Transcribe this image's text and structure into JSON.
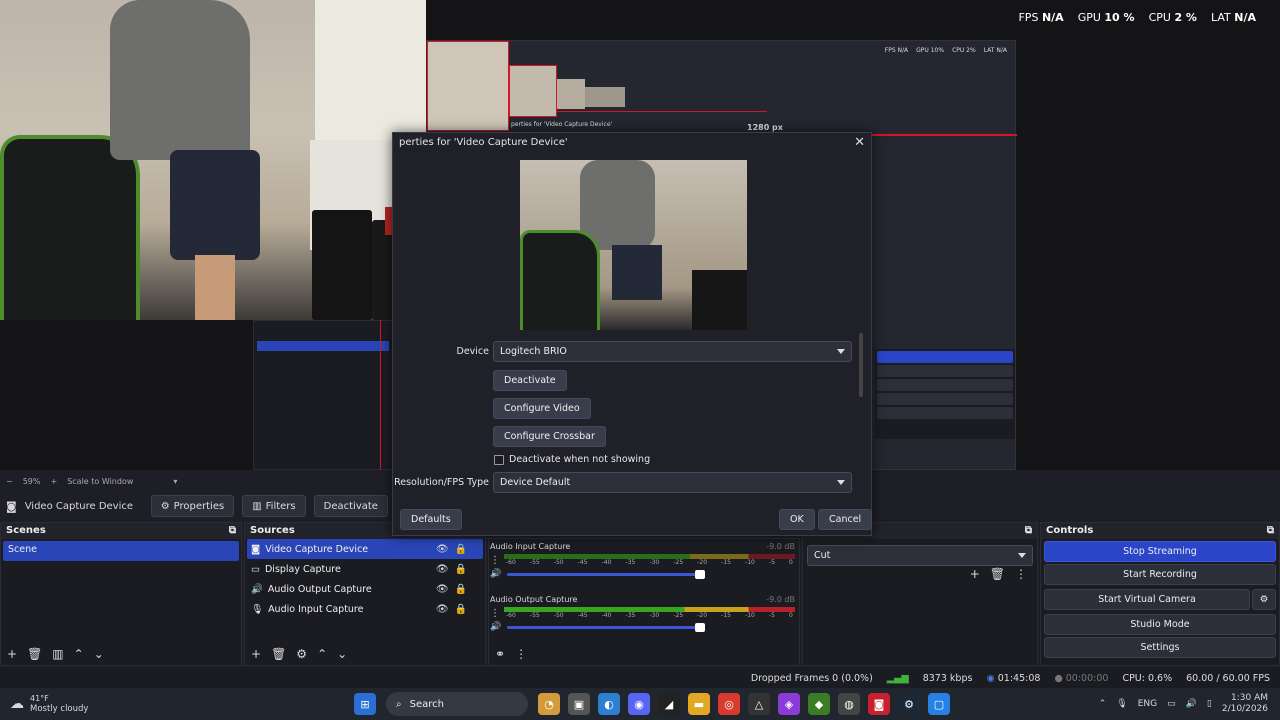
{
  "stats": {
    "fps_label": "FPS",
    "fps_val": "N/A",
    "gpu_label": "GPU",
    "gpu_val": "10 %",
    "cpu_label": "CPU",
    "cpu_val": "2 %",
    "lat_label": "LAT",
    "lat_val": "N/A"
  },
  "nested": {
    "fps": "FPS N/A",
    "gpu": "GPU 10%",
    "cpu": "CPU 2%",
    "lat": "LAT N/A",
    "px_label": "1280 px",
    "props_title": "perties for 'Video Capture Device'"
  },
  "dialog": {
    "title": "perties for 'Video Capture Device'",
    "close": "✕",
    "device_label": "Device",
    "device_value": "Logitech BRIO",
    "deactivate": "Deactivate",
    "configure_video": "Configure Video",
    "configure_crossbar": "Configure Crossbar",
    "deactivate_not_showing": "Deactivate when not showing",
    "resolution_label": "Resolution/FPS Type",
    "resolution_value": "Device Default",
    "defaults": "Defaults",
    "ok": "OK",
    "cancel": "Cancel"
  },
  "zoom": {
    "minus": "−",
    "percent": "59%",
    "plus": "+",
    "scale": "Scale to Window"
  },
  "source_toolbar": {
    "name": "Video Capture Device",
    "properties": "Properties",
    "filters": "Filters",
    "deactivate": "Deactivate"
  },
  "scenes": {
    "title": "Scenes",
    "items": [
      "Scene"
    ]
  },
  "sources": {
    "title": "Sources",
    "items": [
      "Video Capture Device",
      "Display Capture",
      "Audio Output Capture",
      "Audio Input Capture"
    ]
  },
  "mixer": {
    "channels": [
      {
        "name": "Audio Input Capture",
        "db": "-9.0 dB"
      },
      {
        "name": "Audio Output Capture",
        "db": "-9.0 dB"
      }
    ],
    "ticks": [
      "-60",
      "-55",
      "-50",
      "-45",
      "-40",
      "-35",
      "-30",
      "-25",
      "-20",
      "-15",
      "-10",
      "-5",
      "0"
    ]
  },
  "transitions": {
    "title": "ns",
    "value": "Cut"
  },
  "controls": {
    "title": "Controls",
    "stop_streaming": "Stop Streaming",
    "start_recording": "Start Recording",
    "start_virtual_camera": "Start Virtual Camera",
    "studio_mode": "Studio Mode",
    "settings": "Settings"
  },
  "status": {
    "dropped": "Dropped Frames 0 (0.0%)",
    "kbps": "8373 kbps",
    "stream_time": "01:45:08",
    "rec_time": "00:00:00",
    "cpu": "CPU: 0.6%",
    "fps": "60.00 / 60.00 FPS"
  },
  "taskbar": {
    "weather_temp": "41°F",
    "weather_desc": "Mostly cloudy",
    "search": "Search",
    "lang": "ENG",
    "time": "1:30 AM",
    "date": "2/10/2026"
  },
  "colors": {
    "accent": "#2a45c8",
    "live_red": "#d3162a",
    "bg": "#1e1f26"
  }
}
